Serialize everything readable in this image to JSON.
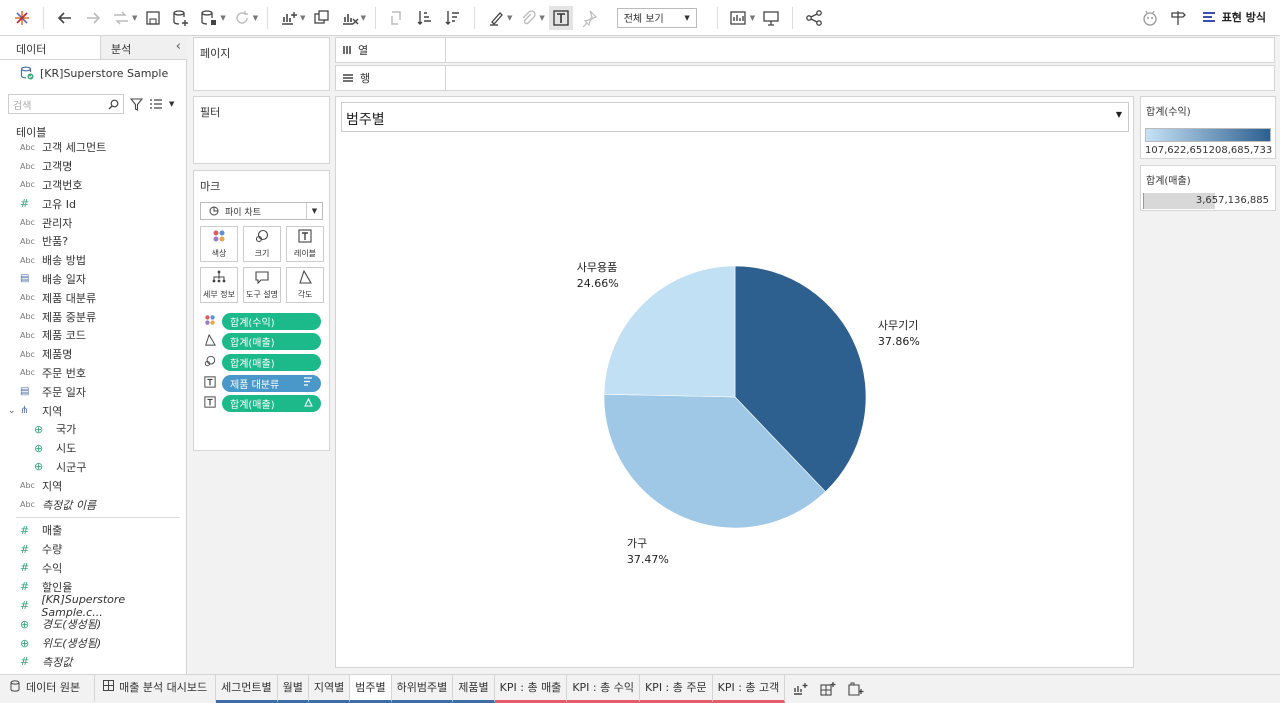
{
  "toolbar": {
    "fit_label": "전체 보기",
    "show_me": "표현 방식"
  },
  "left_pane": {
    "tab_data": "데이터",
    "tab_analytics": "분석",
    "datasource": "[KR]Superstore Sample",
    "search_placeholder": "검색",
    "tables_title": "테이블",
    "dimensions": [
      {
        "type": "Abc",
        "label": "고객 세그먼트"
      },
      {
        "type": "Abc",
        "label": "고객명"
      },
      {
        "type": "Abc",
        "label": "고객번호"
      },
      {
        "type": "#",
        "label": "고유 Id"
      },
      {
        "type": "Abc",
        "label": "관리자"
      },
      {
        "type": "Abc",
        "label": "반품?"
      },
      {
        "type": "Abc",
        "label": "배송 방법"
      },
      {
        "type": "date",
        "label": "배송 일자"
      },
      {
        "type": "Abc",
        "label": "제품 대분류"
      },
      {
        "type": "Abc",
        "label": "제품 중분류"
      },
      {
        "type": "Abc",
        "label": "제품 코드"
      },
      {
        "type": "Abc",
        "label": "제품명"
      },
      {
        "type": "Abc",
        "label": "주문 번호"
      },
      {
        "type": "date",
        "label": "주문 일자"
      }
    ],
    "hierarchy": {
      "label": "지역",
      "children": [
        "국가",
        "시도",
        "시군구"
      ]
    },
    "after_hierarchy": [
      {
        "type": "Abc",
        "label": "지역",
        "italic": false
      },
      {
        "type": "Abc",
        "label": "측정값 이름",
        "italic": true
      }
    ],
    "measures": [
      {
        "type": "#",
        "label": "매출",
        "italic": false
      },
      {
        "type": "#",
        "label": "수량",
        "italic": false
      },
      {
        "type": "#",
        "label": "수익",
        "italic": false
      },
      {
        "type": "#",
        "label": "할인율",
        "italic": false
      },
      {
        "type": "#",
        "label": "[KR]Superstore Sample.c...",
        "italic": true
      },
      {
        "type": "geo",
        "label": "경도(생성됨)",
        "italic": true
      },
      {
        "type": "geo",
        "label": "위도(생성됨)",
        "italic": true
      },
      {
        "type": "#",
        "label": "측정값",
        "italic": true
      }
    ]
  },
  "shelves": {
    "pages": "페이지",
    "filters": "필터",
    "marks": "마크",
    "columns": "열",
    "rows": "행"
  },
  "marks": {
    "type": "파이 차트",
    "cards": [
      {
        "icon": "color-icon",
        "label": "색상"
      },
      {
        "icon": "size-icon",
        "label": "크기"
      },
      {
        "icon": "label-icon",
        "label": "레이블"
      },
      {
        "icon": "detail-icon",
        "label": "세부 정보"
      },
      {
        "icon": "tooltip-icon",
        "label": "도구 설명"
      },
      {
        "icon": "angle-icon",
        "label": "각도"
      }
    ],
    "pills": [
      {
        "icon": "color-icon",
        "label": "합계(수익)",
        "color": "#1cb98a",
        "suffix": ""
      },
      {
        "icon": "angle-icon",
        "label": "합계(매출)",
        "color": "#1cb98a",
        "suffix": ""
      },
      {
        "icon": "size-icon",
        "label": "합계(매출)",
        "color": "#1cb98a",
        "suffix": ""
      },
      {
        "icon": "label-icon",
        "label": "제품 대분류",
        "color": "#4a97c9",
        "suffix": "sort-icon"
      },
      {
        "icon": "label-icon",
        "label": "합계(매출)",
        "color": "#1cb98a",
        "suffix": "delta-icon"
      }
    ]
  },
  "viz": {
    "title": "범주별"
  },
  "chart_data": {
    "type": "pie",
    "slices": [
      {
        "label": "사무기기",
        "percent": 37.86,
        "percent_text": "37.86%",
        "color": "#2d5f8f"
      },
      {
        "label": "가구",
        "percent": 37.47,
        "percent_text": "37.47%",
        "color": "#9fc8e6"
      },
      {
        "label": "사무용품",
        "percent": 24.66,
        "percent_text": "24.66%",
        "color": "#c2e0f3"
      }
    ]
  },
  "legends": {
    "profit_title": "합계(수익)",
    "profit_min": "107,622,651",
    "profit_max": "208,685,733",
    "profit_color_min": "#c6e2f5",
    "profit_color_max": "#2d5f8f",
    "sales_title": "합계(매출)",
    "sales_value": "3,657,136,885"
  },
  "sheet_tabs": [
    {
      "label": "데이터 원본",
      "style": "plain"
    },
    {
      "label": "매출 분석 대시보드",
      "style": "plain"
    },
    {
      "label": "세그먼트별",
      "style": "blue"
    },
    {
      "label": "월별",
      "style": "blue"
    },
    {
      "label": "지역별",
      "style": "blue"
    },
    {
      "label": "범주별",
      "style": "blue",
      "active": true
    },
    {
      "label": "하위범주별",
      "style": "blue"
    },
    {
      "label": "제품별",
      "style": "blue"
    },
    {
      "label": "KPI : 총 매출",
      "style": "red"
    },
    {
      "label": "KPI : 총 수익",
      "style": "red"
    },
    {
      "label": "KPI : 총 주문",
      "style": "red"
    },
    {
      "label": "KPI : 총 고객",
      "style": "red"
    }
  ]
}
